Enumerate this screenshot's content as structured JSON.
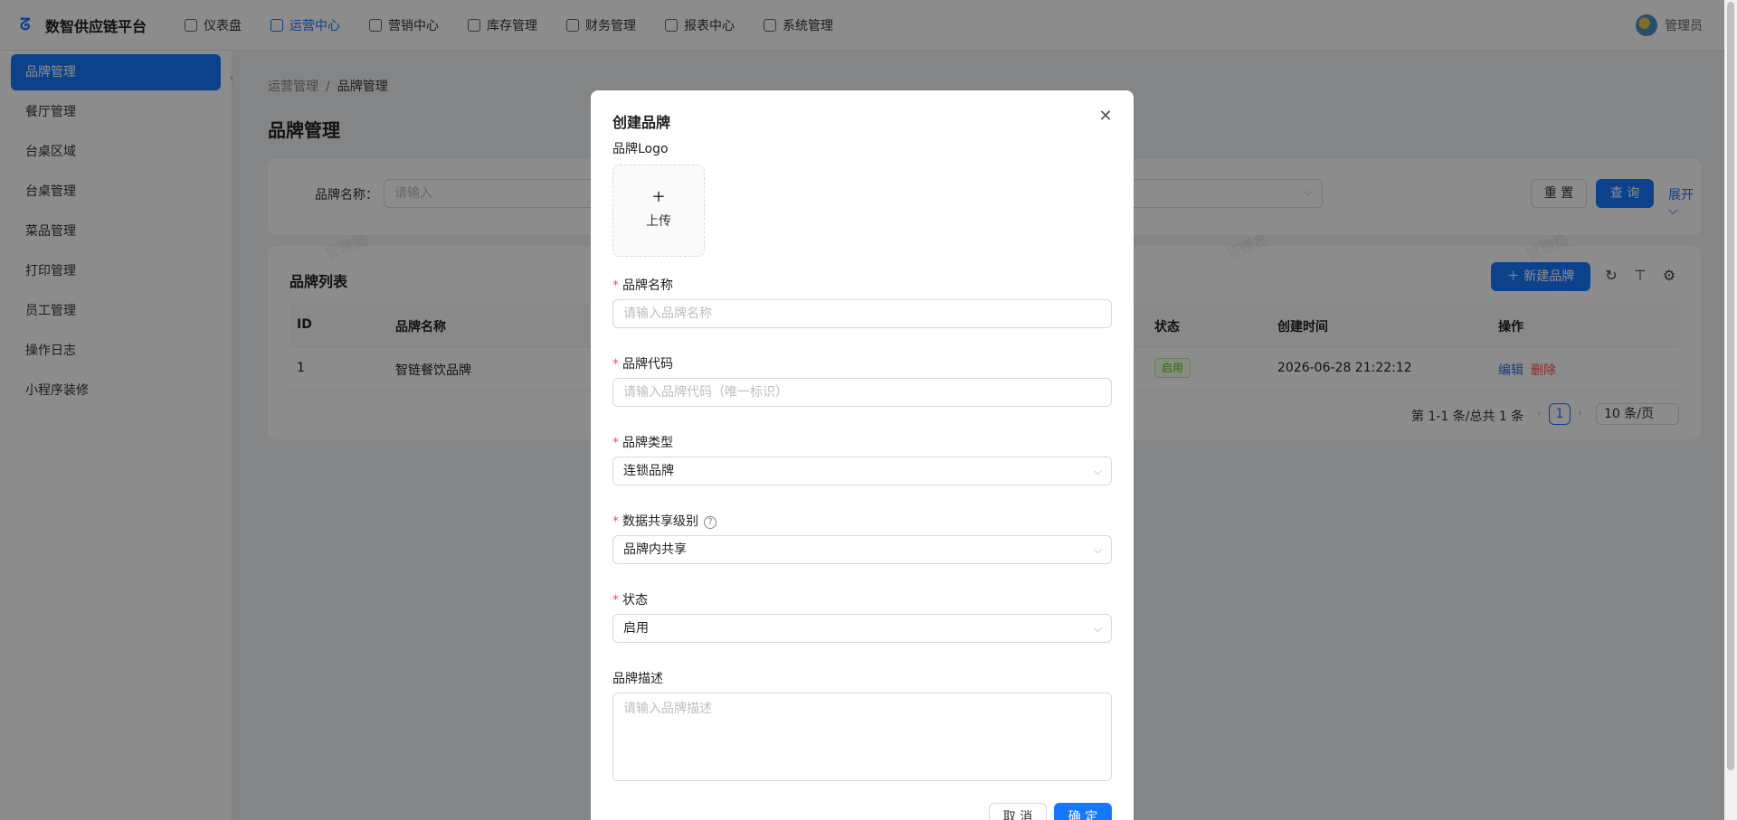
{
  "app": {
    "title": "数智供应链平台"
  },
  "nav": [
    {
      "label": "仪表盘",
      "icon": "dashboard-icon"
    },
    {
      "label": "运营中心",
      "icon": "layout-icon"
    },
    {
      "label": "营销中心",
      "icon": "gift-icon"
    },
    {
      "label": "库存管理",
      "icon": "file-icon"
    },
    {
      "label": "财务管理",
      "icon": "account-book-icon"
    },
    {
      "label": "报表中心",
      "icon": "bar-chart-icon"
    },
    {
      "label": "系统管理",
      "icon": "settings-icon"
    }
  ],
  "user": {
    "name": "管理员"
  },
  "sidebar": {
    "items": [
      {
        "label": "品牌管理"
      },
      {
        "label": "餐厅管理"
      },
      {
        "label": "台桌区域"
      },
      {
        "label": "台桌管理"
      },
      {
        "label": "菜品管理"
      },
      {
        "label": "打印管理"
      },
      {
        "label": "员工管理"
      },
      {
        "label": "操作日志"
      },
      {
        "label": "小程序装修"
      }
    ]
  },
  "breadcrumb": {
    "parent": "运营管理",
    "sep": "/",
    "current": "品牌管理"
  },
  "page": {
    "title": "品牌管理"
  },
  "search": {
    "label": "品牌名称：",
    "placeholder": "请输入",
    "reset": "重 置",
    "query": "查 询",
    "expand": "展开"
  },
  "table": {
    "title": "品牌列表",
    "new_button": "新建品牌",
    "columns": [
      "ID",
      "品牌名称",
      "状态",
      "创建时间",
      "操作"
    ],
    "rows": [
      {
        "id": "1",
        "name": "智链餐饮品牌",
        "status": "启用",
        "created": "2026-06-28 21:22:12",
        "edit": "编辑",
        "delete": "删除"
      }
    ],
    "pagination": {
      "summary": "第 1-1 条/总共 1 条",
      "current": "1",
      "page_size": "10 条/页"
    }
  },
  "watermark": "管理员",
  "modal": {
    "title": "创建品牌",
    "logo_label": "品牌Logo",
    "upload_text": "上传",
    "name_label": "品牌名称",
    "name_placeholder": "请输入品牌名称",
    "code_label": "品牌代码",
    "code_placeholder": "请输入品牌代码（唯一标识）",
    "type_label": "品牌类型",
    "type_value": "连锁品牌",
    "share_label": "数据共享级别",
    "share_value": "品牌内共享",
    "status_label": "状态",
    "status_value": "启用",
    "desc_label": "品牌描述",
    "desc_placeholder": "请输入品牌描述",
    "cancel": "取 消",
    "ok": "确 定"
  },
  "colors": {
    "primary": "#1677ff",
    "danger": "#ff4d4f",
    "success": "#52c41a"
  }
}
